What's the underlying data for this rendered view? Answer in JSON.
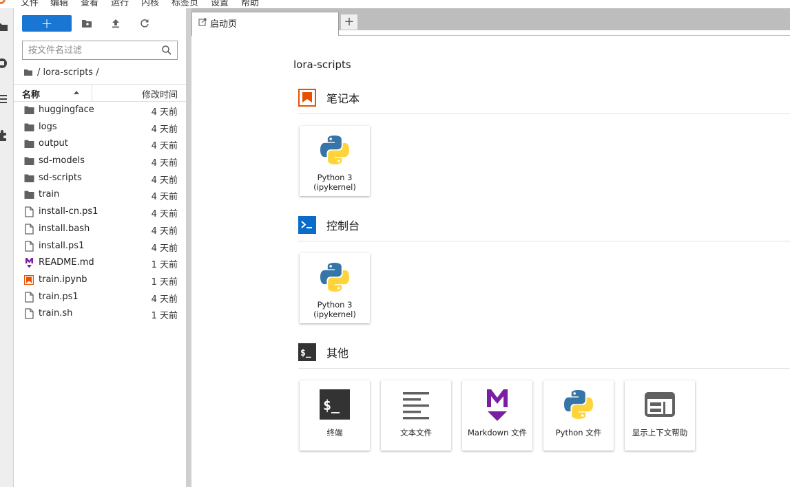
{
  "menubar": {
    "items": [
      "文件",
      "编辑",
      "查看",
      "运行",
      "内核",
      "标签页",
      "设置",
      "帮助"
    ]
  },
  "filebrowser": {
    "new_button_label": "+",
    "search_placeholder": "按文件名过滤",
    "breadcrumb": "/ lora-scripts /",
    "columns": {
      "name": "名称",
      "modified": "修改时间"
    },
    "files": [
      {
        "name": "huggingface",
        "modified": "4 天前",
        "icon": "folder-icon"
      },
      {
        "name": "logs",
        "modified": "4 天前",
        "icon": "folder-icon"
      },
      {
        "name": "output",
        "modified": "4 天前",
        "icon": "folder-icon"
      },
      {
        "name": "sd-models",
        "modified": "4 天前",
        "icon": "folder-icon"
      },
      {
        "name": "sd-scripts",
        "modified": "4 天前",
        "icon": "folder-icon"
      },
      {
        "name": "train",
        "modified": "4 天前",
        "icon": "folder-icon"
      },
      {
        "name": "install-cn.ps1",
        "modified": "4 天前",
        "icon": "file-icon"
      },
      {
        "name": "install.bash",
        "modified": "4 天前",
        "icon": "file-icon"
      },
      {
        "name": "install.ps1",
        "modified": "4 天前",
        "icon": "file-icon"
      },
      {
        "name": "README.md",
        "modified": "1 天前",
        "icon": "markdown-icon"
      },
      {
        "name": "train.ipynb",
        "modified": "1 天前",
        "icon": "notebook-icon"
      },
      {
        "name": "train.ps1",
        "modified": "4 天前",
        "icon": "file-icon"
      },
      {
        "name": "train.sh",
        "modified": "1 天前",
        "icon": "file-icon"
      }
    ]
  },
  "tabs": [
    {
      "label": "启动页",
      "icon": "launcher-icon"
    }
  ],
  "tab_add_label": "+",
  "launcher": {
    "cwd": "lora-scripts",
    "sections": [
      {
        "title": "笔记本",
        "icon": "notebook-icon",
        "cards": [
          {
            "label": "Python 3 (ipykernel)",
            "icon": "python-icon"
          }
        ]
      },
      {
        "title": "控制台",
        "icon": "console-icon",
        "cards": [
          {
            "label": "Python 3 (ipykernel)",
            "icon": "python-icon"
          }
        ]
      },
      {
        "title": "其他",
        "icon": "terminal-icon",
        "cards": [
          {
            "label": "终端",
            "icon": "terminal-icon"
          },
          {
            "label": "文本文件",
            "icon": "text-file-icon"
          },
          {
            "label": "Markdown 文件",
            "icon": "markdown-icon"
          },
          {
            "label": "Python 文件",
            "icon": "python-icon"
          },
          {
            "label": "显示上下文帮助",
            "icon": "context-help-icon"
          }
        ]
      }
    ]
  },
  "colors": {
    "accent": "#1976d2",
    "notebook": "#e65100",
    "markdown": "#7b1fa2",
    "console": "#0a6cc8",
    "terminal": "#333333"
  }
}
